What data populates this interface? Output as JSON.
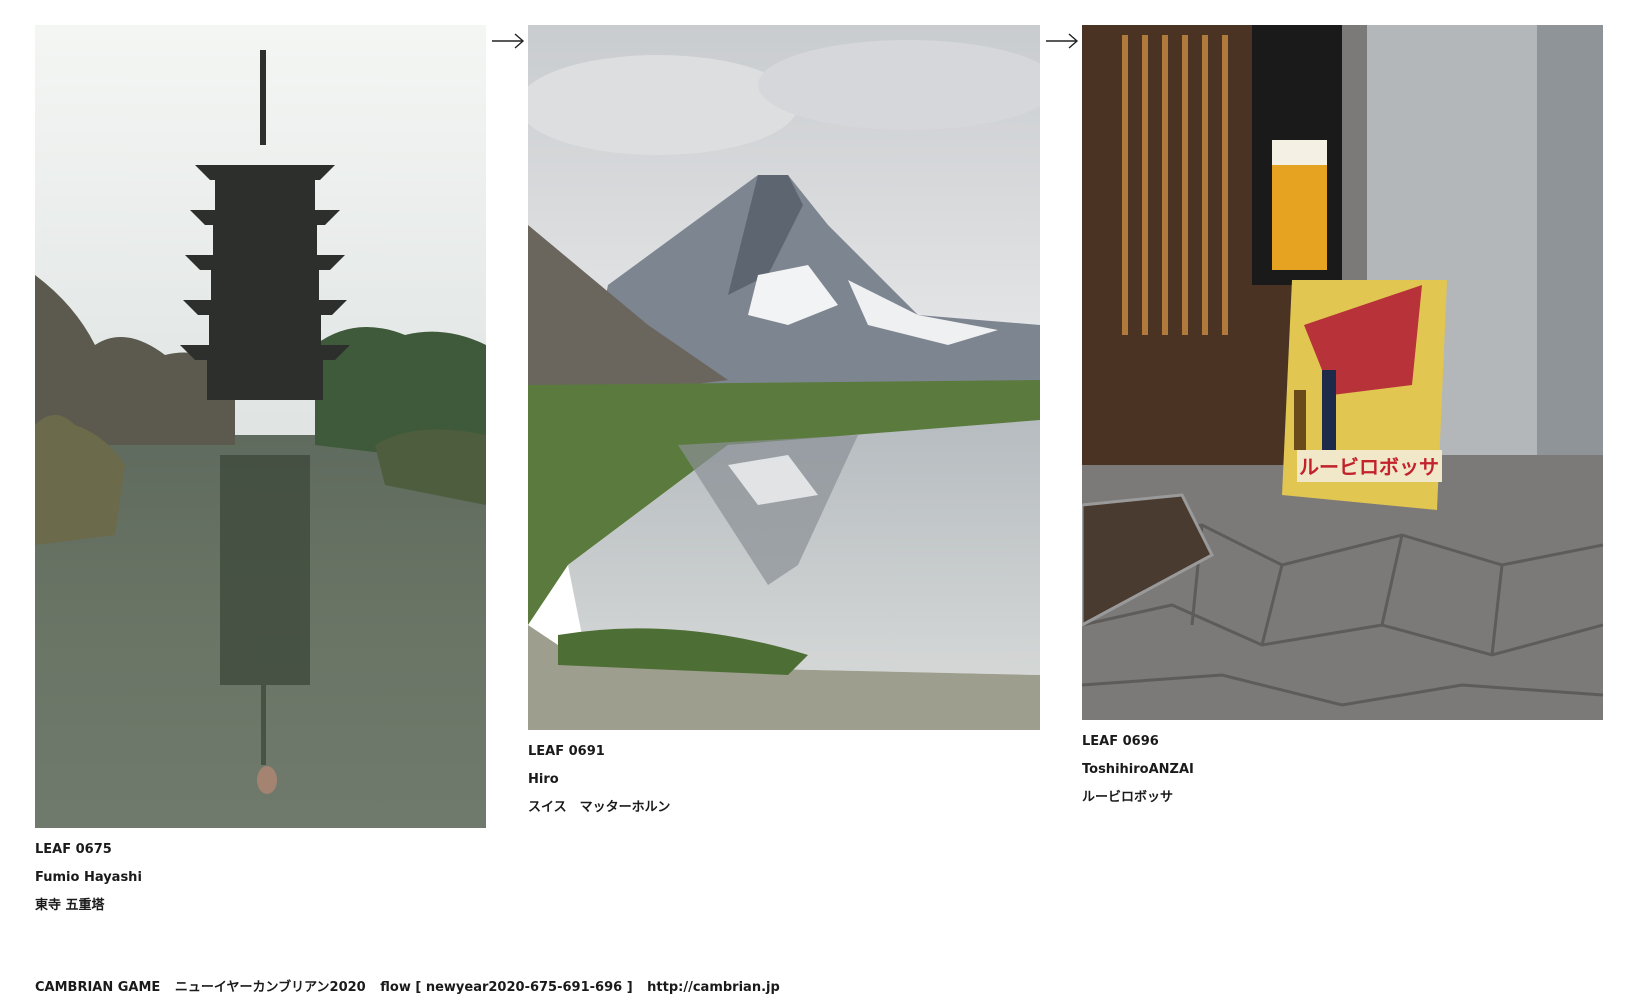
{
  "leaves": [
    {
      "id_label": "LEAF 0675",
      "author": "Fumio Hayashi",
      "title": "東寺 五重塔",
      "image": "pagoda-photo"
    },
    {
      "id_label": "LEAF 0691",
      "author": "Hiro",
      "title": "スイス　マッターホルン",
      "image": "matterhorn-photo"
    },
    {
      "id_label": "LEAF 0696",
      "author": "ToshihiroANZAI",
      "title": "ルービロボッサ",
      "image": "beer-poster-photo"
    }
  ],
  "arrows": [
    "arrow-right-icon",
    "arrow-right-icon"
  ],
  "footer": {
    "game": "CAMBRIAN GAME",
    "event": "ニューイヤーカンブリアン2020",
    "flow": "flow [ newyear2020-675-691-696 ]",
    "url": "http://cambrian.jp"
  },
  "poster_text": "ルービロボッサ"
}
